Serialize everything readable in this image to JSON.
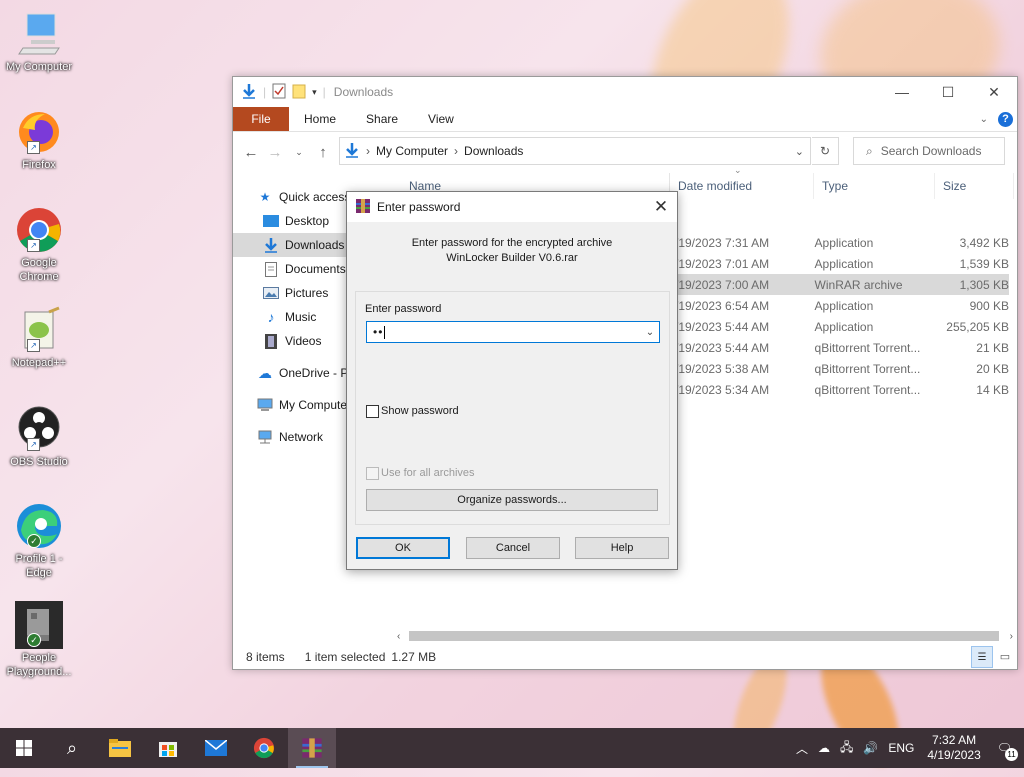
{
  "desktop": {
    "icons": [
      {
        "label": "My Computer"
      },
      {
        "label": "Firefox"
      },
      {
        "label": "Google Chrome"
      },
      {
        "label": "Notepad++"
      },
      {
        "label": "OBS Studio"
      },
      {
        "label": "Profile 1 - Edge"
      },
      {
        "label": "People Playground..."
      }
    ]
  },
  "explorer": {
    "title": "Downloads",
    "ribbon": {
      "file": "File",
      "home": "Home",
      "share": "Share",
      "view": "View"
    },
    "address": {
      "root": "My Computer",
      "current": "Downloads"
    },
    "search_placeholder": "Search Downloads",
    "sidebar": [
      {
        "label": "Quick access"
      },
      {
        "label": "Desktop"
      },
      {
        "label": "Downloads"
      },
      {
        "label": "Documents"
      },
      {
        "label": "Pictures"
      },
      {
        "label": "Music"
      },
      {
        "label": "Videos"
      },
      {
        "label": "OneDrive - Pe"
      },
      {
        "label": "My Compute"
      },
      {
        "label": "Network"
      }
    ],
    "columns": {
      "name": "Name",
      "date": "Date modified",
      "type": "Type",
      "size": "Size"
    },
    "rows": [
      {
        "date": "/19/2023 7:31 AM",
        "type": "Application",
        "size": "3,492 KB"
      },
      {
        "date": "/19/2023 7:01 AM",
        "type": "Application",
        "size": "1,539 KB"
      },
      {
        "date": "/19/2023 7:00 AM",
        "type": "WinRAR archive",
        "size": "1,305 KB"
      },
      {
        "date": "/19/2023 6:54 AM",
        "type": "Application",
        "size": "900 KB"
      },
      {
        "date": "/19/2023 5:44 AM",
        "type": "Application",
        "size": "255,205 KB"
      },
      {
        "date": "/19/2023 5:44 AM",
        "type": "qBittorrent Torrent...",
        "size": "21 KB"
      },
      {
        "date": "/19/2023 5:38 AM",
        "type": "qBittorrent Torrent...",
        "size": "20 KB"
      },
      {
        "date": "/19/2023 5:34 AM",
        "type": "qBittorrent Torrent...",
        "size": "14 KB"
      }
    ],
    "status": {
      "items": "8 items",
      "selected": "1 item selected",
      "size": "1.27 MB"
    }
  },
  "dialog": {
    "title": "Enter password",
    "prompt_line1": "Enter password for the encrypted archive",
    "prompt_line2": "WinLocker Builder V0.6.rar",
    "field_label": "Enter password",
    "password_value": "••",
    "show_password": "Show password",
    "use_all": "Use for all archives",
    "organize": "Organize passwords...",
    "ok": "OK",
    "cancel": "Cancel",
    "help": "Help"
  },
  "taskbar": {
    "language": "ENG",
    "time": "7:32 AM",
    "date": "4/19/2023",
    "notifications": "11"
  },
  "colors": {
    "file_tab": "#b4491f",
    "accent": "#0078d7",
    "taskbar": "#3b3036"
  }
}
